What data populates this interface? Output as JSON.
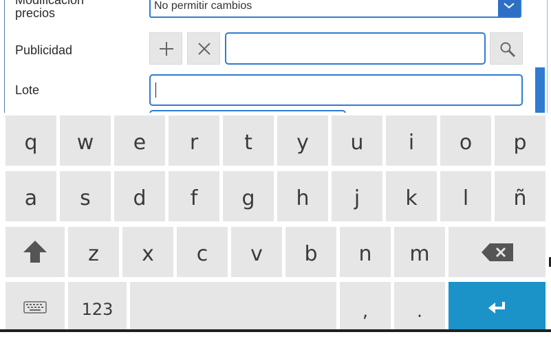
{
  "form": {
    "modificacion_label": "Modificación",
    "precios_label": "precios",
    "precios_value": "No permitir cambios",
    "publicidad_label": "Publicidad",
    "publicidad_value": "",
    "lote_label": "Lote",
    "lote_value": ""
  },
  "keyboard": {
    "row1": [
      "q",
      "w",
      "e",
      "r",
      "t",
      "y",
      "u",
      "i",
      "o",
      "p"
    ],
    "row2": [
      "a",
      "s",
      "d",
      "f",
      "g",
      "h",
      "j",
      "k",
      "l",
      "ñ"
    ],
    "row3": [
      "z",
      "x",
      "c",
      "v",
      "b",
      "n",
      "m"
    ],
    "numbers_label": "123",
    "comma": ",",
    "period": "."
  },
  "icons": {
    "dropdown": "chevron-down-icon",
    "add": "plus-icon",
    "clear": "close-icon",
    "search": "search-icon",
    "shift": "shift-arrow-icon",
    "backspace": "backspace-icon",
    "keyboard_layout": "keyboard-icon",
    "enter": "enter-icon"
  },
  "colors": {
    "accent": "#2f7bd0",
    "key_bg": "#e6e6e6",
    "enter_bg": "#1b93c9"
  }
}
